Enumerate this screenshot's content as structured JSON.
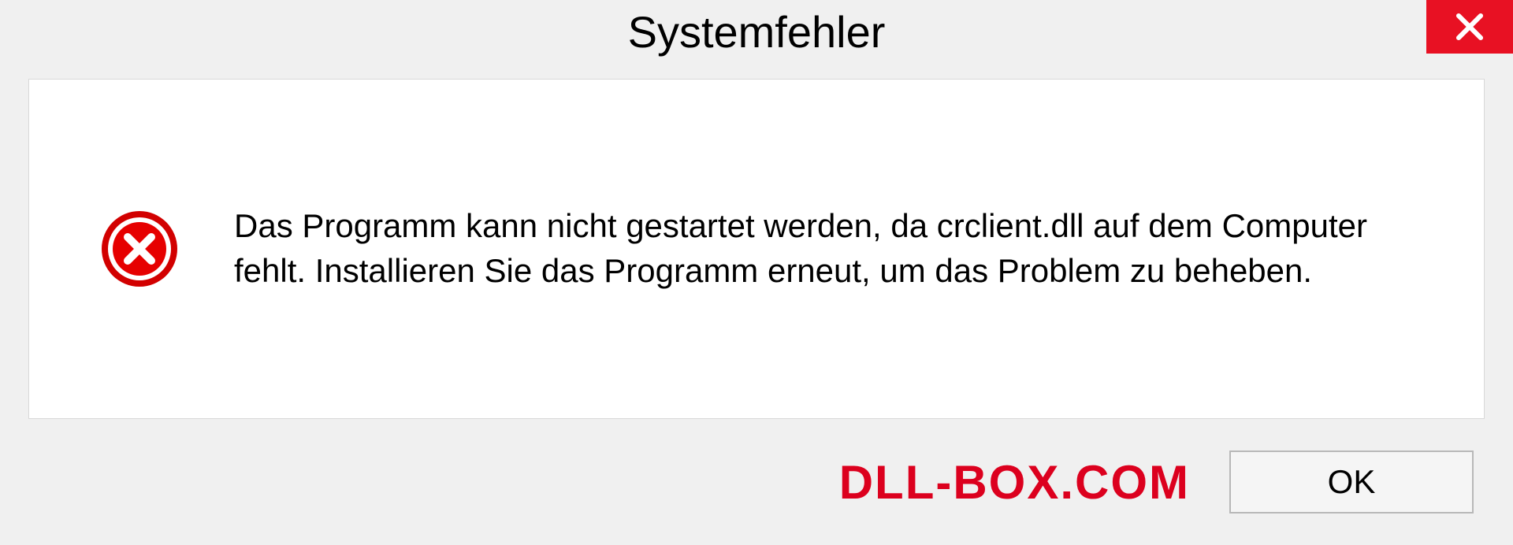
{
  "dialog": {
    "title": "Systemfehler",
    "message": "Das Programm kann nicht gestartet werden, da crclient.dll auf dem Computer fehlt. Installieren Sie das Programm erneut, um das Problem zu beheben.",
    "ok_label": "OK"
  },
  "watermark": "DLL-BOX.COM"
}
